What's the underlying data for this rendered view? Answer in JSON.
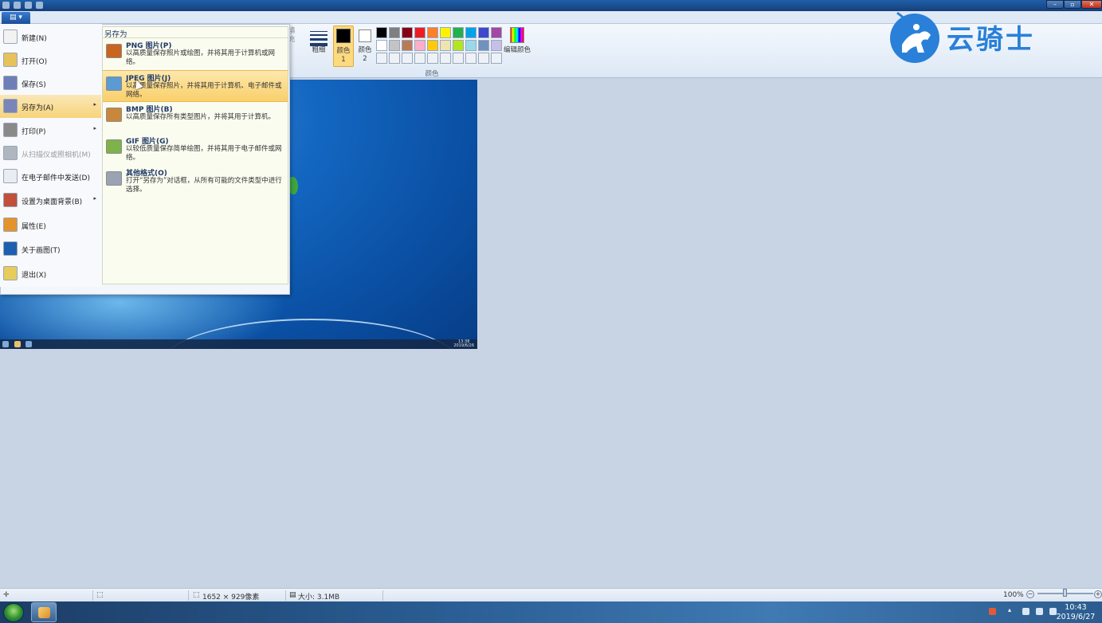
{
  "titlebar": {
    "title": "",
    "window_buttons": {
      "minimize": "–",
      "maximize": "▫",
      "close": "✕"
    }
  },
  "file_menu": {
    "button_label": "▤ ▾",
    "left_items": [
      {
        "label": "新建(N)",
        "icon": "new-document-icon",
        "color": "#f2f2f2"
      },
      {
        "label": "打开(O)",
        "icon": "open-folder-icon",
        "color": "#e7c25a"
      },
      {
        "label": "保存(S)",
        "icon": "save-disk-icon",
        "color": "#6e7fb8"
      },
      {
        "label": "另存为(A)",
        "icon": "save-as-icon",
        "color": "#7a86b8",
        "arrow": "▸"
      },
      {
        "label": "打印(P)",
        "icon": "printer-icon",
        "color": "#8a8a8a",
        "arrow": "▸"
      },
      {
        "label": "从扫描仪或照相机(M)",
        "icon": "scanner-icon",
        "color": "#b0b6bf"
      },
      {
        "label": "在电子邮件中发送(D)",
        "icon": "email-icon",
        "color": "#e9ecf1"
      },
      {
        "label": "设置为桌面背景(B)",
        "icon": "desktop-background-icon",
        "color": "#c0503a",
        "arrow": "▸"
      },
      {
        "label": "属性(E)",
        "icon": "checkmark-icon",
        "color": "#e4942c"
      },
      {
        "label": "关于画图(T)",
        "icon": "info-icon",
        "color": "#1f5fb0"
      },
      {
        "label": "退出(X)",
        "icon": "exit-icon",
        "color": "#e7cc5c"
      }
    ],
    "save_as": {
      "header": "另存为",
      "options": [
        {
          "title": "PNG 图片(P)",
          "desc": "以高质量保存照片或绘图，并将其用于计算机或网络。",
          "icon": "png-image-icon",
          "color": "#c9651f"
        },
        {
          "title": "JPEG 图片(J)",
          "desc": "以高质量保存照片，并将其用于计算机、电子邮件或网络。",
          "icon": "jpeg-image-icon",
          "color": "#5a9bd3"
        },
        {
          "title": "BMP 图片(B)",
          "desc": "以高质量保存所有类型图片，并将其用于计算机。",
          "icon": "bmp-image-icon",
          "color": "#c8873b"
        },
        {
          "title": "GIF 图片(G)",
          "desc": "以较低质量保存简单绘图，并将其用于电子邮件或网络。",
          "icon": "gif-image-icon",
          "color": "#7db34a"
        },
        {
          "title": "其他格式(O)",
          "desc": "打开“另存为”对话框，从所有可能的文件类型中进行选择。",
          "icon": "other-formats-icon",
          "color": "#9aa3b4"
        }
      ]
    }
  },
  "ribbon": {
    "cut_label_1": "填",
    "cut_label_2": "充",
    "thickness_label": "粗细",
    "color1_label": "颜色 1",
    "color2_label": "颜色 2",
    "edit_colors_label": "编辑颜色",
    "group_colors_label": "颜色",
    "palette": [
      "#000000",
      "#7f7f7f",
      "#880015",
      "#ed1c24",
      "#ff7f27",
      "#fff200",
      "#22b14c",
      "#00a2e8",
      "#3f48cc",
      "#a349a4",
      "#ffffff",
      "#c3c3c3",
      "#b97a57",
      "#ffaec9",
      "#ffc90e",
      "#efe4b0",
      "#b5e61d",
      "#99d9ea",
      "#7092be",
      "#c8bfe7",
      "#eef2f7",
      "#eef2f7",
      "#eef2f7",
      "#eef2f7",
      "#eef2f7",
      "#eef2f7",
      "#eef2f7",
      "#eef2f7",
      "#eef2f7",
      "#eef2f7"
    ],
    "color1": "#000000",
    "color2": "#ffffff"
  },
  "canvas": {
    "clock_time": "13:38",
    "clock_date": "2019/6/26"
  },
  "statusbar": {
    "dimensions": "1652 × 929像素",
    "size": "大小: 3.1MB",
    "zoom": "100%",
    "zoom_out": "−",
    "zoom_in": "+"
  },
  "taskbar": {
    "time": "10:43",
    "date": "2019/6/27",
    "tray_chevron": "▴"
  },
  "watermark": {
    "text": "云骑士",
    "color": "#2a80d8"
  }
}
